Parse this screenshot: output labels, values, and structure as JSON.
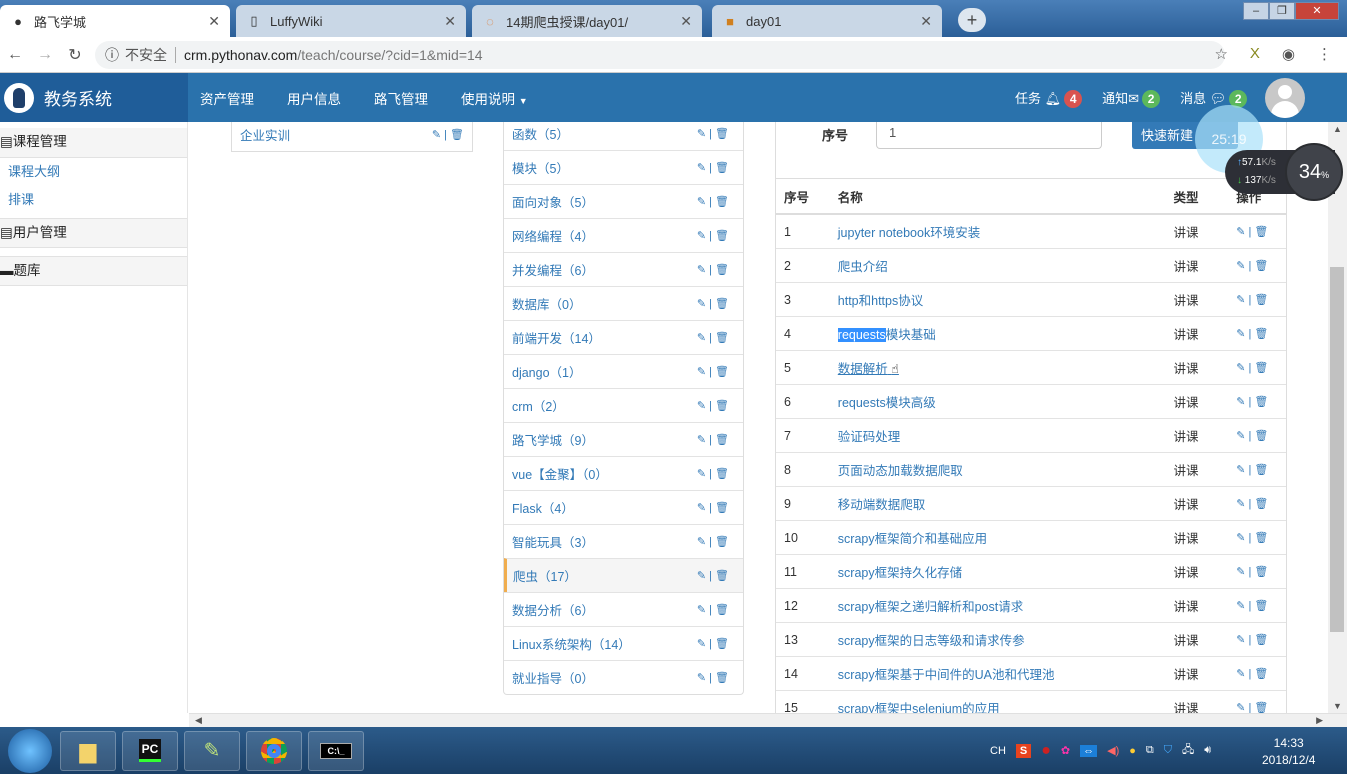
{
  "browser": {
    "tabs": [
      {
        "title": "路飞学城",
        "active": true
      },
      {
        "title": "LuffyWiki"
      },
      {
        "title": "14期爬虫授课/day01/"
      },
      {
        "title": "day01"
      }
    ],
    "security_label": "不安全",
    "url_host": "crm.pythonav.com",
    "url_path": "/teach/course/?cid=1&mid=14"
  },
  "nav": {
    "brand": "教务系统",
    "menu": [
      "资产管理",
      "用户信息",
      "路飞管理",
      "使用说明"
    ],
    "tasks": {
      "label": "任务",
      "count": "4",
      "color": "#d9534f"
    },
    "notices": {
      "label": "通知",
      "count": "2",
      "color": "#5cb85c"
    },
    "messages": {
      "label": "消息",
      "count": "2",
      "color": "#5cb85c"
    }
  },
  "sidebar": {
    "groups": [
      {
        "title": "课程管理",
        "items": [
          "课程大纲",
          "排课"
        ]
      },
      {
        "title": "用户管理",
        "items": []
      },
      {
        "title": "题库",
        "items": []
      }
    ]
  },
  "categories_left": [
    {
      "name": "企业实训"
    }
  ],
  "modules": [
    "函数（5）",
    "模块（5）",
    "面向对象（5）",
    "网络编程（4）",
    "并发编程（6）",
    "数据库（0）",
    "前端开发（14）",
    "django（1）",
    "crm（2）",
    "路飞学城（9）",
    "vue【金聚】（0）",
    "Flask（4）",
    "智能玩具（3）",
    "爬虫（17）",
    "数据分析（6）",
    "Linux系统架构（14）",
    "就业指导（0）"
  ],
  "active_module": "爬虫（17）",
  "form": {
    "label": "序号",
    "value": "1",
    "button": "快速新建"
  },
  "table": {
    "headers": [
      "序号",
      "名称",
      "类型",
      "操作"
    ],
    "rows": [
      [
        "1",
        "jupyter notebook环境安装",
        "讲课"
      ],
      [
        "2",
        "爬虫介绍",
        "讲课"
      ],
      [
        "3",
        "http和https协议",
        "讲课"
      ],
      [
        "4",
        "requests模块基础",
        "讲课"
      ],
      [
        "5",
        "数据解析",
        "讲课"
      ],
      [
        "6",
        "requests模块高级",
        "讲课"
      ],
      [
        "7",
        "验证码处理",
        "讲课"
      ],
      [
        "8",
        "页面动态加载数据爬取",
        "讲课"
      ],
      [
        "9",
        "移动端数据爬取",
        "讲课"
      ],
      [
        "10",
        "scrapy框架简介和基础应用",
        "讲课"
      ],
      [
        "11",
        "scrapy框架持久化存储",
        "讲课"
      ],
      [
        "12",
        "scrapy框架之递归解析和post请求",
        "讲课"
      ],
      [
        "13",
        "scrapy框架的日志等级和请求传参",
        "讲课"
      ],
      [
        "14",
        "scrapy框架基于中间件的UA池和代理池",
        "讲课"
      ],
      [
        "15",
        "scrapy框架中selenium的应用",
        "讲课"
      ]
    ]
  },
  "overlay": {
    "timer": "25:19",
    "upload": "57.1",
    "download": "137",
    "speed_unit": "K/s",
    "percent": "34"
  },
  "taskbar": {
    "apps": [
      "PC",
      "",
      "",
      "C:\\_"
    ],
    "lang": "CH",
    "time": "14:33",
    "date": "2018/12/4"
  }
}
